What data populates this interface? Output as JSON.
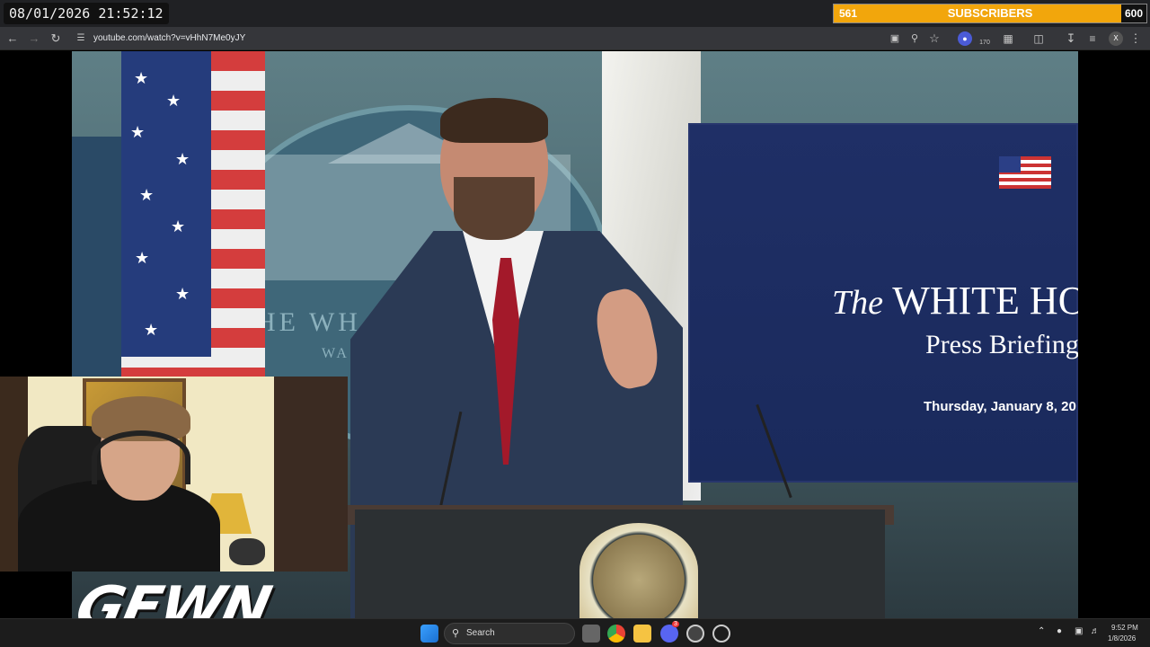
{
  "overlay": {
    "timestamp": "08/01/2026 21:52:12",
    "subscribers": {
      "count": "561",
      "label": "SUBSCRIBERS",
      "goal": "600",
      "progress": 0.935,
      "color": "#f2a60c"
    },
    "logo_text": "GEWN"
  },
  "browser": {
    "url": "youtube.com/watch?v=vHhN7Me0yJY",
    "badge_count": "170",
    "profile_initial": "X",
    "icons": [
      "back-icon",
      "forward-icon",
      "reload-icon",
      "site-info-icon",
      "install-icon",
      "zoom-icon",
      "star-icon",
      "extension-icon",
      "puzzle-icon",
      "split-view-icon",
      "download-icon",
      "media-icon",
      "profile-icon",
      "menu-icon"
    ]
  },
  "video": {
    "wall_text": "HE WH",
    "wall_subtext": "WA",
    "screen_title_italic": "The",
    "screen_title": "WHITE HO",
    "screen_subtitle": "Press Briefing",
    "screen_date": "Thursday, January 8, 20"
  },
  "taskbar": {
    "search_label": "Search",
    "time": "9:52 PM",
    "date": "1/8/2026",
    "notification_badge": "3"
  }
}
